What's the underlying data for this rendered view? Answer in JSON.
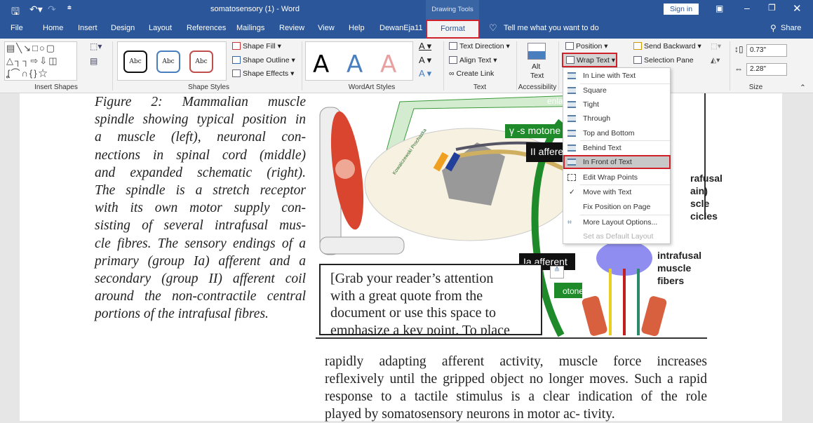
{
  "title_bar": {
    "doc_title": "somatosensory (1)  -  Word",
    "context_label": "Drawing Tools",
    "sign_in": "Sign in",
    "quick_access": {
      "save": "save-icon",
      "undo": "undo-icon",
      "redo": "redo-icon",
      "customize": "customize-icon"
    }
  },
  "tabs": [
    {
      "label": "File"
    },
    {
      "label": "Home"
    },
    {
      "label": "Insert"
    },
    {
      "label": "Design"
    },
    {
      "label": "Layout"
    },
    {
      "label": "References"
    },
    {
      "label": "Mailings"
    },
    {
      "label": "Review"
    },
    {
      "label": "View"
    },
    {
      "label": "Help"
    },
    {
      "label": "DewanEja11"
    },
    {
      "label": "Format",
      "active": true
    }
  ],
  "tell_me": "Tell me what you want to do",
  "share": "Share",
  "ribbon": {
    "insert_shapes": {
      "label": "Insert Shapes"
    },
    "shape_styles": {
      "label": "Shape Styles",
      "presets": [
        "Abc",
        "Abc",
        "Abc"
      ],
      "fill": "Shape Fill",
      "outline": "Shape Outline",
      "effects": "Shape Effects"
    },
    "wordart": {
      "label": "WordArt Styles",
      "presets": [
        "A",
        "A",
        "A"
      ]
    },
    "text": {
      "label": "Text",
      "direction": "Text Direction",
      "align": "Align Text",
      "link": "Create Link"
    },
    "accessibility": {
      "label": "Accessibility",
      "alt_text_1": "Alt",
      "alt_text_2": "Text"
    },
    "arrange": {
      "position": "Position",
      "wrap_text": "Wrap Text",
      "send_backward": "Send Backward",
      "selection_pane": "Selection Pane"
    },
    "size": {
      "label": "Size",
      "height": "0.73\"",
      "width": "2.28\""
    }
  },
  "wrap_menu": {
    "items": [
      {
        "label": "In Line with Text"
      },
      {
        "label": "Square"
      },
      {
        "label": "Tight"
      },
      {
        "label": "Through"
      },
      {
        "label": "Top and Bottom"
      },
      {
        "label": "Behind Text"
      },
      {
        "label": "In Front of Text",
        "highlighted": true
      },
      {
        "label": "Edit Wrap Points"
      },
      {
        "label": "Move with Text",
        "checked": true
      },
      {
        "label": "Fix Position on Page"
      },
      {
        "label": "More Layout Options..."
      },
      {
        "label": "Set as Default Layout",
        "disabled": true
      }
    ]
  },
  "document": {
    "caption_lines": [
      "Figure 2: Mammalian muscle",
      "spindle showing typical position in",
      "a muscle (left), neuronal con-",
      "nections in spinal cord (middle)",
      "and expanded schematic (right).",
      "The spindle is a stretch receptor",
      "with its own motor supply con-",
      "sisting of several intrafusal mus-",
      "cle fibres. The sensory endings of a",
      "primary (group Ia) afferent and a",
      "secondary (group II) afferent coil",
      "around the non-contractile central",
      "portions of the intrafusal fibres."
    ],
    "figure_labels": {
      "enlarged": "enla",
      "gamma": "γ -s motone",
      "ii_afferent": "II affere",
      "ia_afferent": "Ia afferent",
      "motoneuron": "otoneuron",
      "intrafusal_chain": [
        "rafusal",
        "ain)",
        "scle",
        "cicles"
      ],
      "intrafusal_fibers": [
        "intrafusal",
        "muscle",
        "fibers"
      ],
      "authors": "Kowalczewski Prochazka"
    },
    "quote_lines": [
      "[Grab your reader’s attention",
      "with a great quote from the",
      "document or use this space to",
      "emphasize a key point. To place"
    ],
    "body_lines": [
      "rapidly adapting afferent activity, muscle force increases",
      "reflexively until the gripped object no longer moves. Such a rapid",
      "response to a tactile stimulus is a clear indication of the role",
      "played by somatosensory neurons in motor ac- tivity."
    ]
  },
  "colors": {
    "brand": "#2b579a",
    "highlight": "#d0202a",
    "green": "#1f8a2a",
    "muscle": "#d9452f"
  }
}
